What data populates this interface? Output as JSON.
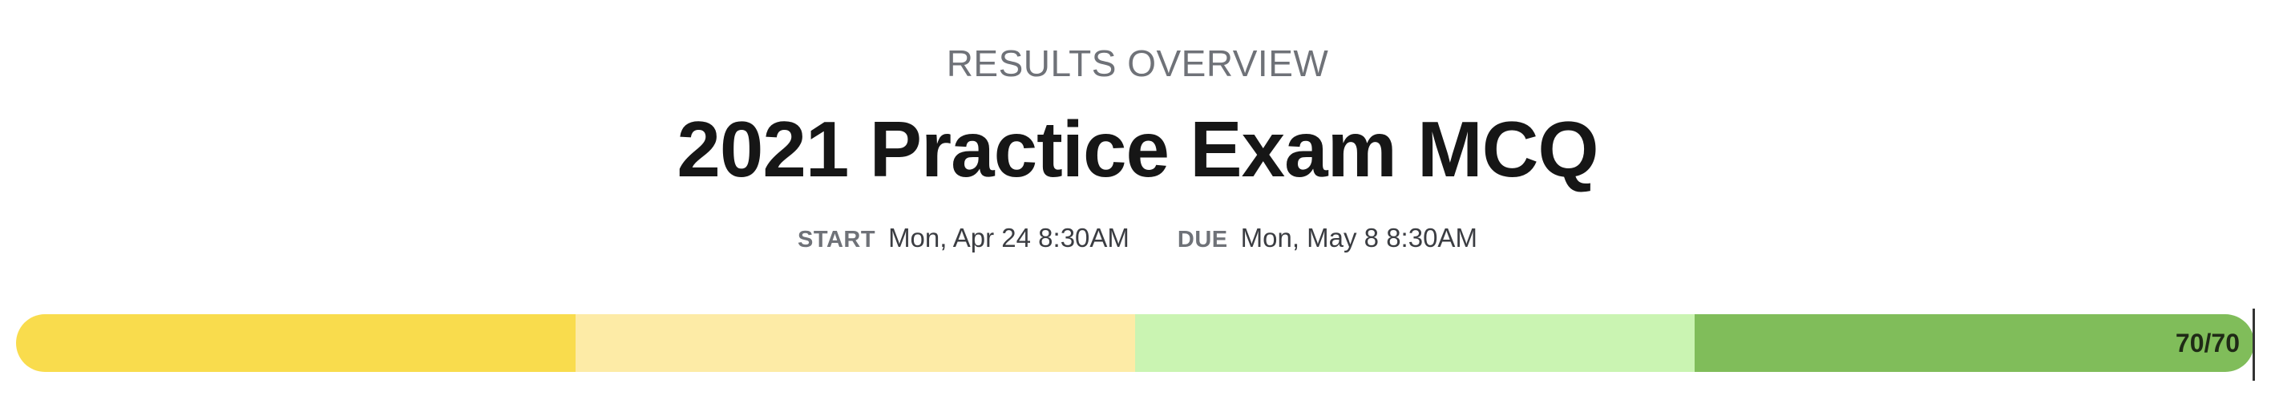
{
  "header": {
    "overview_label": "RESULTS OVERVIEW",
    "exam_title": "2021 Practice Exam MCQ"
  },
  "dates": {
    "start_label": "START",
    "start_value": "Mon, Apr 24 8:30AM",
    "due_label": "DUE",
    "due_value": "Mon, May 8 8:30AM"
  },
  "score": {
    "text": "70/70",
    "earned": 70,
    "total": 70
  },
  "progress_bands": [
    {
      "name": "band-1",
      "color": "#f9dc4d"
    },
    {
      "name": "band-2",
      "color": "#fdeba6"
    },
    {
      "name": "band-3",
      "color": "#caf4b2"
    },
    {
      "name": "band-4",
      "color": "#80bd5a"
    }
  ]
}
